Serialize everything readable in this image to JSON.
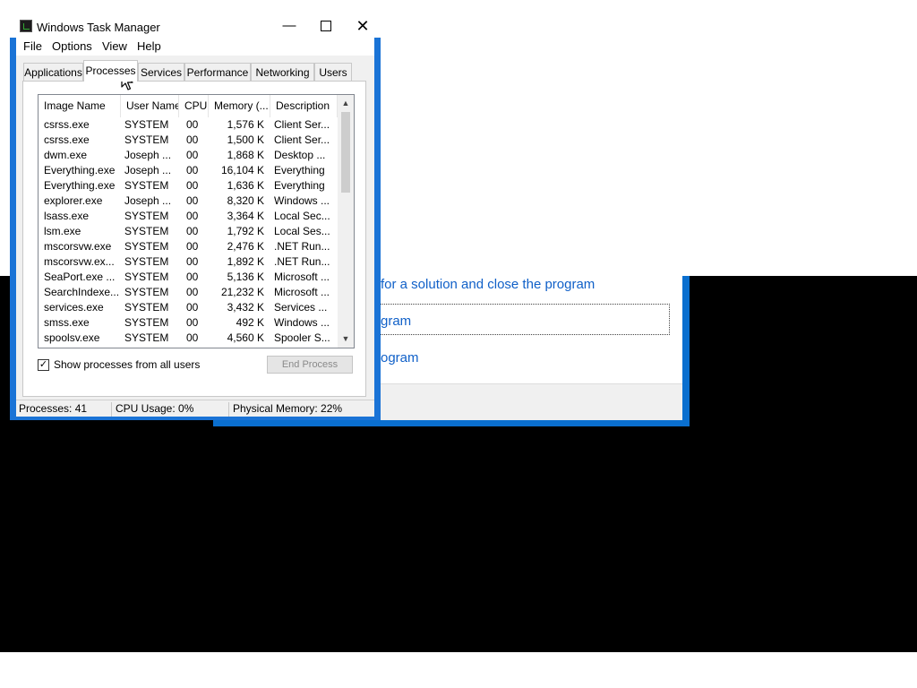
{
  "background_dialog": {
    "link1": "for a solution and close the program",
    "link2": "gram",
    "link3": "ogram"
  },
  "task_manager": {
    "title": "Windows Task Manager",
    "window_buttons": {
      "minimize": "—",
      "close": "✕"
    },
    "menu": [
      "File",
      "Options",
      "View",
      "Help"
    ],
    "tabs": [
      "Applications",
      "Processes",
      "Services",
      "Performance",
      "Networking",
      "Users"
    ],
    "active_tab": "Processes",
    "columns": [
      "Image Name",
      "User Name",
      "CPU",
      "Memory (...",
      "Description"
    ],
    "processes": [
      {
        "name": "csrss.exe",
        "user": "SYSTEM",
        "cpu": "00",
        "memory": "1,576 K",
        "description": "Client Ser..."
      },
      {
        "name": "csrss.exe",
        "user": "SYSTEM",
        "cpu": "00",
        "memory": "1,500 K",
        "description": "Client Ser..."
      },
      {
        "name": "dwm.exe",
        "user": "Joseph ...",
        "cpu": "00",
        "memory": "1,868 K",
        "description": "Desktop ..."
      },
      {
        "name": "Everything.exe",
        "user": "Joseph ...",
        "cpu": "00",
        "memory": "16,104 K",
        "description": "Everything"
      },
      {
        "name": "Everything.exe",
        "user": "SYSTEM",
        "cpu": "00",
        "memory": "1,636 K",
        "description": "Everything"
      },
      {
        "name": "explorer.exe",
        "user": "Joseph ...",
        "cpu": "00",
        "memory": "8,320 K",
        "description": "Windows ..."
      },
      {
        "name": "lsass.exe",
        "user": "SYSTEM",
        "cpu": "00",
        "memory": "3,364 K",
        "description": "Local Sec..."
      },
      {
        "name": "lsm.exe",
        "user": "SYSTEM",
        "cpu": "00",
        "memory": "1,792 K",
        "description": "Local Ses..."
      },
      {
        "name": "mscorsvw.exe",
        "user": "SYSTEM",
        "cpu": "00",
        "memory": "2,476 K",
        "description": ".NET Run..."
      },
      {
        "name": "mscorsvw.ex...",
        "user": "SYSTEM",
        "cpu": "00",
        "memory": "1,892 K",
        "description": ".NET Run..."
      },
      {
        "name": "SeaPort.exe ...",
        "user": "SYSTEM",
        "cpu": "00",
        "memory": "5,136 K",
        "description": "Microsoft ..."
      },
      {
        "name": "SearchIndexe...",
        "user": "SYSTEM",
        "cpu": "00",
        "memory": "21,232 K",
        "description": "Microsoft ..."
      },
      {
        "name": "services.exe",
        "user": "SYSTEM",
        "cpu": "00",
        "memory": "3,432 K",
        "description": "Services ..."
      },
      {
        "name": "smss.exe",
        "user": "SYSTEM",
        "cpu": "00",
        "memory": "492 K",
        "description": "Windows ..."
      },
      {
        "name": "spoolsv.exe",
        "user": "SYSTEM",
        "cpu": "00",
        "memory": "4,560 K",
        "description": "Spooler S..."
      }
    ],
    "show_all_label": "Show processes from all users",
    "show_all_checked": true,
    "end_process_label": "End Process",
    "status": {
      "processes": "Processes: 41",
      "cpu": "CPU Usage: 0%",
      "memory": "Physical Memory: 22%"
    },
    "icons": {
      "app": "task-manager-icon",
      "cursor": "mouse-pointer-icon"
    },
    "colors": {
      "frame": "#1a73d6",
      "link": "#1060c8"
    }
  }
}
